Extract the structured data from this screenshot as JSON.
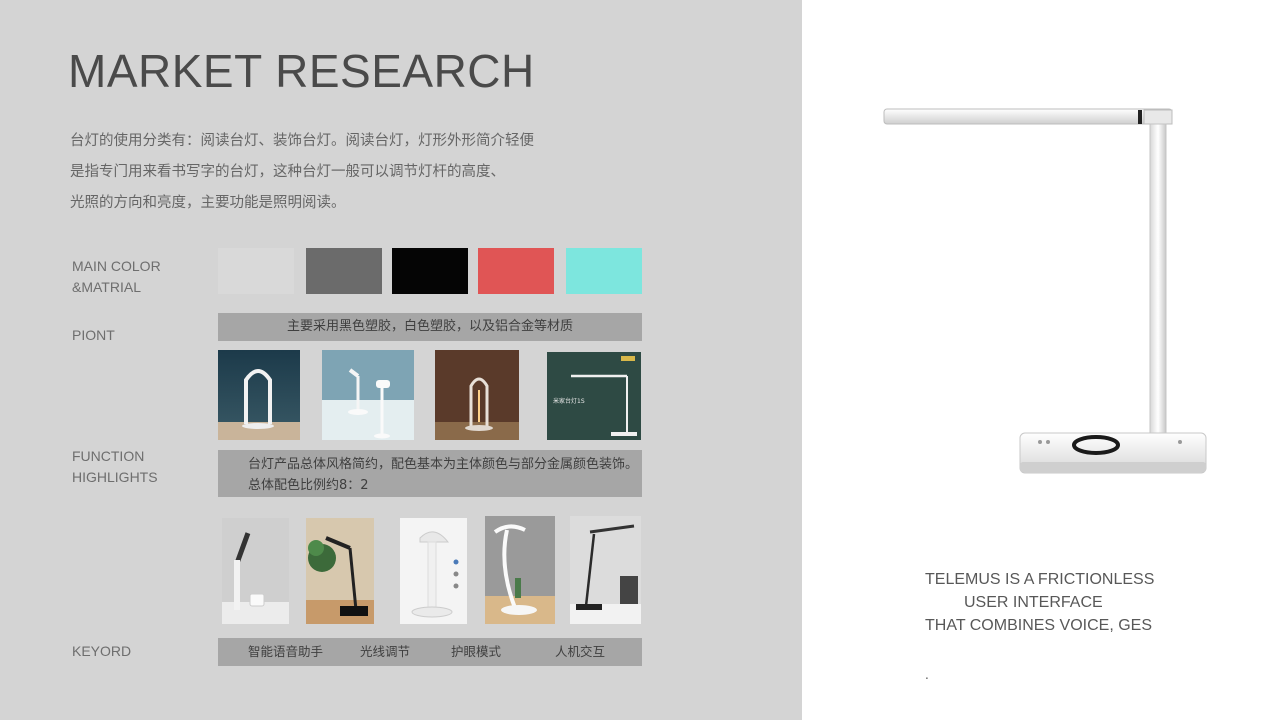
{
  "title": "MARKET RESEARCH",
  "intro_lines": [
    "台灯的使用分类有：阅读台灯、装饰台灯。阅读台灯，灯形外形简介轻便",
    "是指专门用来看书写字的台灯，这种台灯一般可以调节灯杆的高度、",
    "光照的方向和亮度，主要功能是照明阅读。"
  ],
  "labels": {
    "main_color_1": "MAIN COLOR",
    "main_color_2": "&MATRIAL",
    "point": "PIONT",
    "function_1": "FUNCTION",
    "function_2": "HIGHLIGHTS",
    "keyword": "KEYORD"
  },
  "colors": {
    "swatches": [
      "#d9d9d9",
      "#6b6b6b",
      "#050505",
      "#e05555",
      "#7de6de"
    ],
    "panel_bg": "#d4d4d4",
    "bar_bg": "#a6a6a6"
  },
  "point_text": "主要采用黑色塑胶，白色塑胶，以及铝合金等材质",
  "function_text": {
    "line1": "台灯产品总体风格简约，配色基本为主体颜色与部分金属颜色装饰。",
    "line2": "总体配色比例约8：2"
  },
  "function_images": {
    "fourth_caption": "米家台灯1S"
  },
  "keywords": [
    "智能语音助手",
    "光线调节",
    "护眼模式",
    "人机交互"
  ],
  "tagline": {
    "line1": "TELEMUS IS A FRICTIONLESS",
    "line2": "USER INTERFACE",
    "line3": "THAT COMBINES VOICE, GES"
  },
  "footnote": "."
}
